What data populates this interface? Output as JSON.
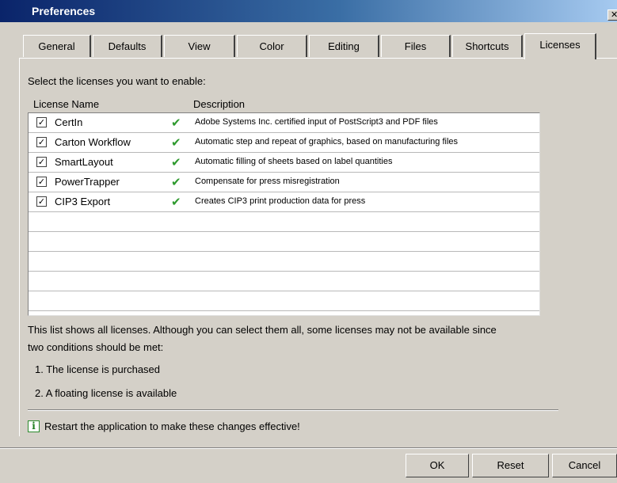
{
  "window": {
    "title": "Preferences",
    "close_glyph": "✕"
  },
  "tabs": [
    {
      "label": "General"
    },
    {
      "label": "Defaults"
    },
    {
      "label": "View"
    },
    {
      "label": "Color"
    },
    {
      "label": "Editing"
    },
    {
      "label": "Files"
    },
    {
      "label": "Shortcuts"
    },
    {
      "label": "Licenses",
      "active": true
    }
  ],
  "licenses": {
    "intro": "Select the licenses you want to enable:",
    "columns": {
      "name": "License Name",
      "description": "Description"
    },
    "rows": [
      {
        "checked": true,
        "name": "CertIn",
        "status_icon": "green-checkmark-icon",
        "description": "Adobe Systems Inc. certified input of PostScript3 and PDF files"
      },
      {
        "checked": true,
        "name": "Carton Workflow",
        "status_icon": "green-checkmark-icon",
        "description": "Automatic step and repeat of graphics, based on manufacturing files"
      },
      {
        "checked": true,
        "name": "SmartLayout",
        "status_icon": "green-checkmark-icon",
        "description": "Automatic filling of sheets based on label quantities"
      },
      {
        "checked": true,
        "name": "PowerTrapper",
        "status_icon": "green-checkmark-icon",
        "description": "Compensate for press misregistration"
      },
      {
        "checked": true,
        "name": "CIP3 Export",
        "status_icon": "green-checkmark-icon",
        "description": "Creates CIP3 print production data for press"
      }
    ],
    "check_glyph": "✔",
    "box_glyph": "✓",
    "note_line1": "This list shows all licenses. Although you can select them all, some licenses may not be available since",
    "note_line2": "two conditions should be met:",
    "condition1": "1. The license is purchased",
    "condition2": "2. A floating license is available",
    "info_glyph": "i",
    "restart": "Restart the application to make these changes effective!"
  },
  "buttons": {
    "ok": "OK",
    "reset": "Reset",
    "cancel": "Cancel"
  },
  "colors": {
    "title_gradient_start": "#0a246a",
    "title_gradient_end": "#a6caf0",
    "face": "#d4d0c8",
    "check": "#2e9a2e"
  }
}
